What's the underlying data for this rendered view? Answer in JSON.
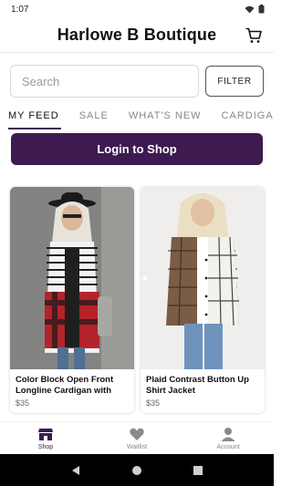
{
  "status_bar": {
    "time": "1:07"
  },
  "header": {
    "title": "Harlowe B Boutique",
    "cart_icon": "cart-icon"
  },
  "search": {
    "placeholder": "Search",
    "value": ""
  },
  "filter": {
    "label": "FILTER"
  },
  "tabs": [
    {
      "label": "MY FEED",
      "active": true
    },
    {
      "label": "SALE",
      "active": false
    },
    {
      "label": "WHAT'S NEW",
      "active": false
    },
    {
      "label": "CARDIGANS",
      "active": false
    }
  ],
  "login": {
    "label": "Login to Shop"
  },
  "products": [
    {
      "name": "Color Block Open Front Longline Cardigan with",
      "price": "$35"
    },
    {
      "name": "Plaid Contrast Button Up Shirt Jacket",
      "price": "$35"
    }
  ],
  "bottom_nav": [
    {
      "label": "Shop",
      "icon": "shop-icon",
      "active": true
    },
    {
      "label": "Waitlist",
      "icon": "heart-icon",
      "active": false
    },
    {
      "label": "Account",
      "icon": "account-icon",
      "active": false
    }
  ],
  "colors": {
    "accent": "#3d1a4f",
    "background": "#ffffff"
  }
}
